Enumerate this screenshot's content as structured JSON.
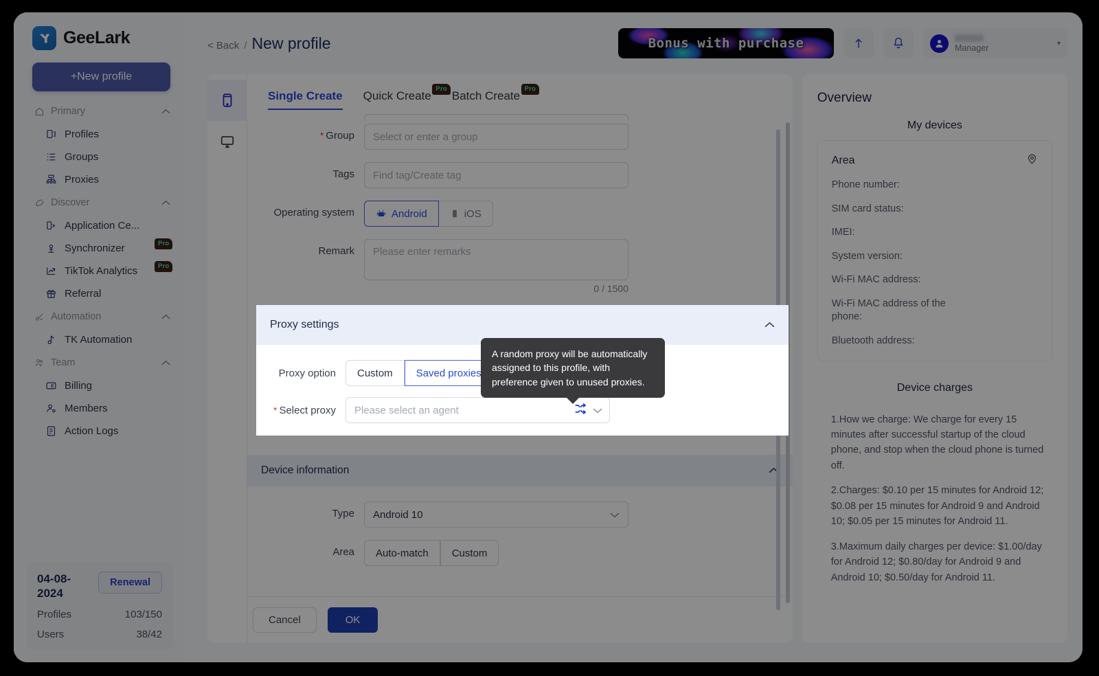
{
  "brand": {
    "name": "GeeLark",
    "logo_icon": "geelark-logo-icon"
  },
  "sidebar": {
    "new_profile_label": "+New profile",
    "groups": [
      {
        "label": "Primary",
        "icon": "home-icon",
        "items": [
          {
            "label": "Profiles",
            "icon": "profiles-icon"
          },
          {
            "label": "Groups",
            "icon": "groups-list-icon"
          },
          {
            "label": "Proxies",
            "icon": "proxies-network-icon"
          }
        ]
      },
      {
        "label": "Discover",
        "icon": "discover-leaf-icon",
        "items": [
          {
            "label": "Application Ce...",
            "icon": "application-center-icon"
          },
          {
            "label": "Synchronizer",
            "icon": "synchronizer-icon",
            "badge": "Pro"
          },
          {
            "label": "TikTok Analytics",
            "icon": "analytics-chart-icon",
            "badge": "Pro"
          },
          {
            "label": "Referral",
            "icon": "gift-icon"
          }
        ]
      },
      {
        "label": "Automation",
        "icon": "automation-icon",
        "items": [
          {
            "label": "TK Automation",
            "icon": "tiktok-note-icon"
          }
        ]
      },
      {
        "label": "Team",
        "icon": "team-icon",
        "items": [
          {
            "label": "Billing",
            "icon": "billing-card-icon"
          },
          {
            "label": "Members",
            "icon": "members-icon"
          },
          {
            "label": "Action Logs",
            "icon": "action-logs-icon"
          }
        ]
      }
    ],
    "card": {
      "date": "04-08-2024",
      "renewal_label": "Renewal",
      "rows": [
        {
          "label": "Profiles",
          "value": "103/150"
        },
        {
          "label": "Users",
          "value": "38/42"
        }
      ]
    }
  },
  "topbar": {
    "back_label": "< Back",
    "separator": "/",
    "title": "New profile",
    "promo_text": "Bonus with purchase",
    "upload_icon": "upload-arrow-icon",
    "bell_icon": "notification-bell-icon",
    "avatar_icon": "user-avatar-icon",
    "user_role": "Manager",
    "chip_caret": "▾"
  },
  "rail": [
    {
      "icon": "mobile-phone-icon",
      "active": true
    },
    {
      "icon": "desktop-monitor-icon",
      "active": false
    }
  ],
  "tabs": [
    {
      "label": "Single Create",
      "active": true
    },
    {
      "label": "Quick Create",
      "badge": "Pro"
    },
    {
      "label": "Batch Create",
      "badge": "Pro"
    }
  ],
  "form": {
    "group": {
      "label": "Group",
      "required": true,
      "placeholder": "Select or enter a group",
      "value": ""
    },
    "tags": {
      "label": "Tags",
      "required": false,
      "placeholder": "Find tag/Create tag",
      "value": ""
    },
    "os": {
      "label": "Operating system",
      "options": [
        {
          "label": "Android",
          "icon": "android-robot-icon",
          "active": true
        },
        {
          "label": "iOS",
          "icon": "apple-device-icon",
          "active": false
        }
      ]
    },
    "remark": {
      "label": "Remark",
      "placeholder": "Please enter remarks",
      "value": "",
      "counter": "0 / 1500"
    }
  },
  "proxy_settings": {
    "title": "Proxy settings",
    "collapse_icon": "chevron-up-icon",
    "option": {
      "label": "Proxy option",
      "options": [
        {
          "label": "Custom",
          "active": false
        },
        {
          "label": "Saved proxies",
          "active": true
        }
      ]
    },
    "select_proxy": {
      "label": "Select proxy",
      "required": true,
      "placeholder": "Please select an agent",
      "value": "",
      "shuffle_icon": "shuffle-random-icon",
      "dropdown_icon": "chevron-down-icon"
    }
  },
  "tooltip": {
    "text": "A random proxy will be automatically assigned to this profile, with preference given to unused proxies."
  },
  "device_information": {
    "title": "Device information",
    "collapse_icon": "chevron-up-icon",
    "type": {
      "label": "Type",
      "value": "Android 10",
      "dropdown_icon": "chevron-down-icon"
    },
    "area": {
      "label": "Area",
      "options": [
        {
          "label": "Auto-match",
          "active": false
        },
        {
          "label": "Custom",
          "active": false
        }
      ]
    }
  },
  "footer": {
    "cancel_label": "Cancel",
    "ok_label": "OK"
  },
  "overview": {
    "title": "Overview",
    "my_devices_label": "My devices",
    "area_label": "Area",
    "pin_icon": "location-pin-icon",
    "fields": [
      "Phone number:",
      "SIM card status:",
      "IMEI:",
      "System version:",
      "Wi-Fi MAC address:",
      "Wi-Fi MAC address of the phone:",
      "Bluetooth address:"
    ],
    "device_charges_label": "Device charges",
    "charges": [
      "1.How we charge: We charge for every 15 minutes after successful startup of the cloud phone, and stop when the cloud phone is turned off.",
      "2.Charges: $0.10 per 15 minutes for Android 12; $0.08 per 15 minutes for Android 9 and Android 10; $0.05 per 15 minutes for Android 11.",
      "3.Maximum daily charges per device: $1.00/day for Android 12; $0.80/day for Android 9 and Android 10; $0.50/day for Android 11."
    ]
  },
  "colors": {
    "accent_blue": "#2b49d8",
    "primary_button": "#1f3fb0",
    "sidebar_button": "#4c5aa8",
    "section_header": "#eaeef8",
    "tooltip_bg": "#3a3a3c",
    "required_red": "#e03b3b",
    "pro_badge_bg": "#3c2216",
    "pro_badge_text": "#46e0b8"
  }
}
